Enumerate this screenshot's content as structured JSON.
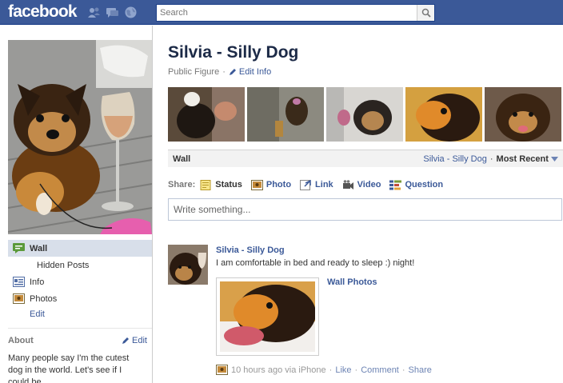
{
  "topbar": {
    "logo": "facebook",
    "search_placeholder": "Search",
    "icons": [
      "friends-icon",
      "messages-icon",
      "notifications-globe-icon"
    ]
  },
  "sidebar": {
    "nav": [
      {
        "label": "Wall",
        "icon": "wall-icon"
      },
      {
        "label": "Hidden Posts"
      },
      {
        "label": "Info",
        "icon": "info-icon"
      },
      {
        "label": "Photos",
        "icon": "photos-icon"
      }
    ],
    "edit_label": "Edit",
    "about": {
      "title": "About",
      "edit_label": "Edit",
      "text": "Many people say I'm the cutest dog in the world. Let's see if I could be."
    }
  },
  "page": {
    "name": "Silvia - Silly Dog",
    "category": "Public Figure",
    "separator": "·",
    "edit_info": "Edit Info"
  },
  "wall": {
    "title": "Wall",
    "filter_link": "Silvia - Silly Dog",
    "separator": "·",
    "sort_label": "Most Recent"
  },
  "share": {
    "label": "Share:",
    "items": [
      {
        "label": "Status",
        "icon": "status-icon"
      },
      {
        "label": "Photo",
        "icon": "photo-icon"
      },
      {
        "label": "Link",
        "icon": "link-icon"
      },
      {
        "label": "Video",
        "icon": "video-icon"
      },
      {
        "label": "Question",
        "icon": "question-icon"
      }
    ],
    "composer_placeholder": "Write something..."
  },
  "story": {
    "author": "Silvia - Silly Dog",
    "message": "I am comfortable in bed and ready to sleep :) night!",
    "attachment_title": "Wall Photos",
    "time": "10 hours ago via iPhone",
    "sep": "·",
    "actions": [
      "Like",
      "Comment",
      "Share"
    ]
  },
  "colors": {
    "brand_blue": "#3b5998",
    "link_blue": "#3b5998",
    "nav_active_bg": "#d8dfea"
  }
}
